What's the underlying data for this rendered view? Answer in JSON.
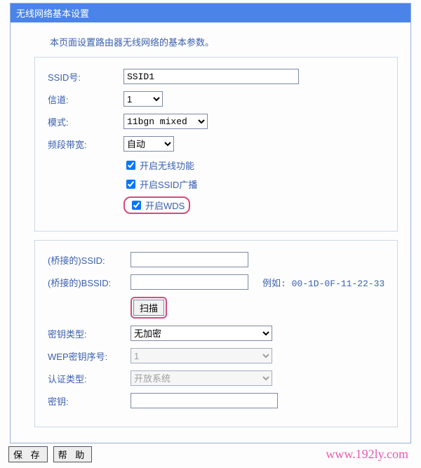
{
  "title": "无线网络基本设置",
  "intro": "本页面设置路由器无线网络的基本参数。",
  "basic": {
    "ssid_label": "SSID号:",
    "ssid_value": "SSID1",
    "channel_label": "信道:",
    "channel_value": "1",
    "mode_label": "模式:",
    "mode_value": "11bgn mixed",
    "bandwidth_label": "频段带宽:",
    "bandwidth_value": "自动",
    "cb_wireless": "开启无线功能",
    "cb_ssid_broadcast": "开启SSID广播",
    "cb_wds": "开启WDS"
  },
  "wds": {
    "bridge_ssid_label": "(桥接的)SSID:",
    "bridge_ssid_value": "",
    "bridge_bssid_label": "(桥接的)BSSID:",
    "bridge_bssid_value": "",
    "example_text": "例如: 00-1D-0F-11-22-33",
    "scan_button": "扫描",
    "keytype_label": "密钥类型:",
    "keytype_value": "无加密",
    "wep_index_label": "WEP密钥序号:",
    "wep_index_value": "1",
    "auth_label": "认证类型:",
    "auth_value": "开放系统",
    "key_label": "密钥:",
    "key_value": ""
  },
  "buttons": {
    "save": "保 存",
    "help": "帮 助"
  },
  "watermark": "www.192ly.com"
}
